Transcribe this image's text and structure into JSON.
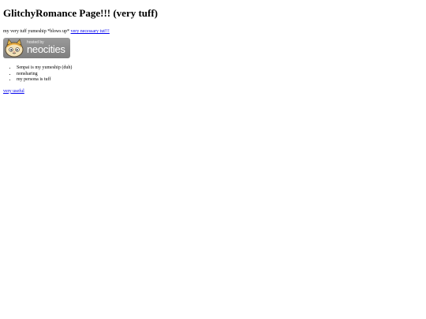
{
  "page": {
    "title": "GlitchyRomance Page!!! (very tuff)",
    "intro_text": "my very tuff yumeship *blows up* ",
    "intro_link": "very necessary tut!!!",
    "badge": {
      "hosted_by": "hosted by",
      "brand": "neocities",
      "icon": "neocities-cat-icon"
    },
    "list_items": [
      "Senpai is my yumeship (duh)",
      "nonsharing",
      "my persona is tuff"
    ],
    "footer_link": "very useful"
  }
}
